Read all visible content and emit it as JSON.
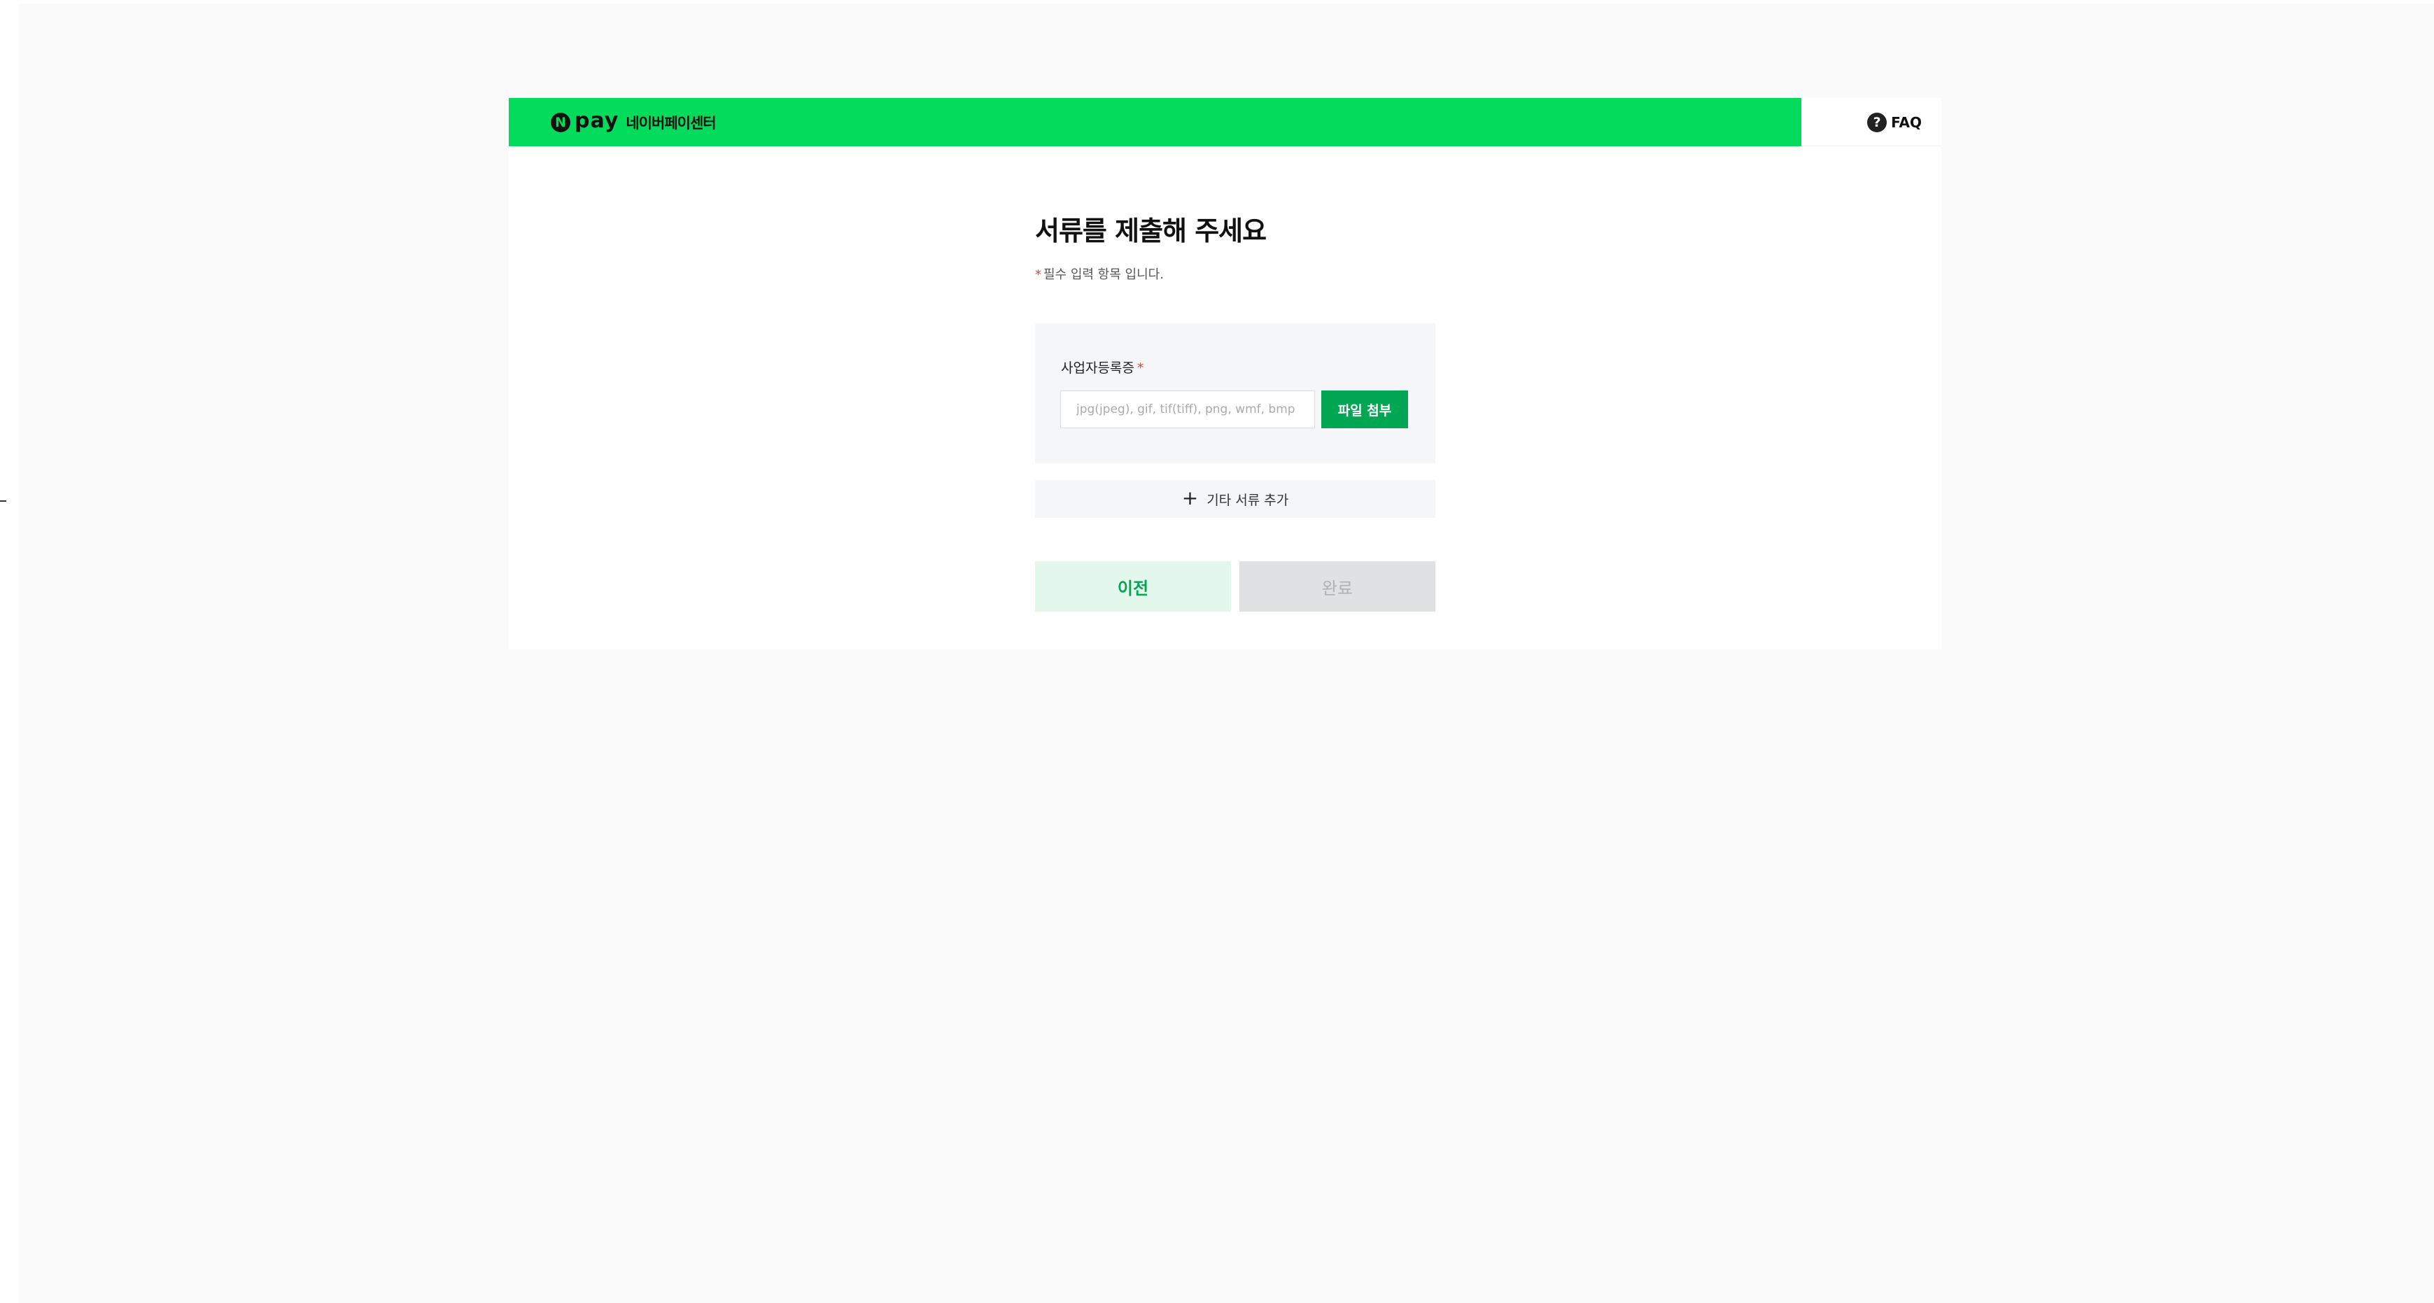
{
  "header": {
    "brand_logo_letter": "N",
    "brand_logo_word": "pay",
    "brand_name": "네이버페이센터",
    "faq_icon": "?",
    "faq_label": "FAQ",
    "accent_color": "#03db5d"
  },
  "main": {
    "title": "서류를 제출해 주세요",
    "required_mark": "*",
    "required_note": "필수 입력 항목 입니다.",
    "upload": {
      "label": "사업자등록증",
      "required_mark": "*",
      "placeholder": "jpg(jpeg), gif, tif(tiff), png, wmf, bmp 파일",
      "attach_button": "파일 첨부",
      "button_color": "#00a651"
    },
    "add_document": {
      "icon": "+",
      "label": "기타 서류 추가"
    },
    "buttons": {
      "prev": "이전",
      "done": "완료"
    }
  }
}
